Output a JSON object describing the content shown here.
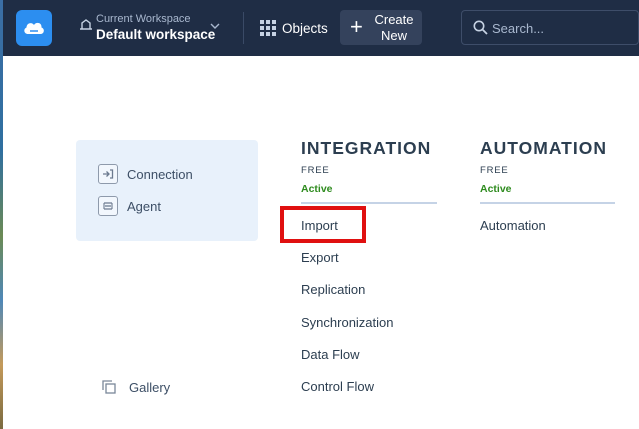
{
  "topbar": {
    "workspace_label": "Current Workspace",
    "workspace_value": "Default workspace",
    "objects_label": "Objects",
    "create_label": "Create\nNew",
    "search_placeholder": "Search..."
  },
  "panel": {
    "items": [
      {
        "label": "Connection",
        "icon": "connection-icon"
      },
      {
        "label": "Agent",
        "icon": "agent-icon"
      }
    ],
    "gallery_label": "Gallery"
  },
  "columns": [
    {
      "title": "INTEGRATION",
      "tier": "FREE",
      "status": "Active",
      "items": [
        "Import",
        "Export",
        "Replication",
        "Synchronization",
        "Data Flow",
        "Control Flow"
      ]
    },
    {
      "title": "AUTOMATION",
      "tier": "FREE",
      "status": "Active",
      "items": [
        "Automation"
      ]
    }
  ],
  "colors": {
    "topbar": "#1f2d45",
    "accent": "#2c8ef0",
    "active": "#2e8b1e",
    "highlight": "#e01010"
  },
  "highlighted_item": "Import"
}
